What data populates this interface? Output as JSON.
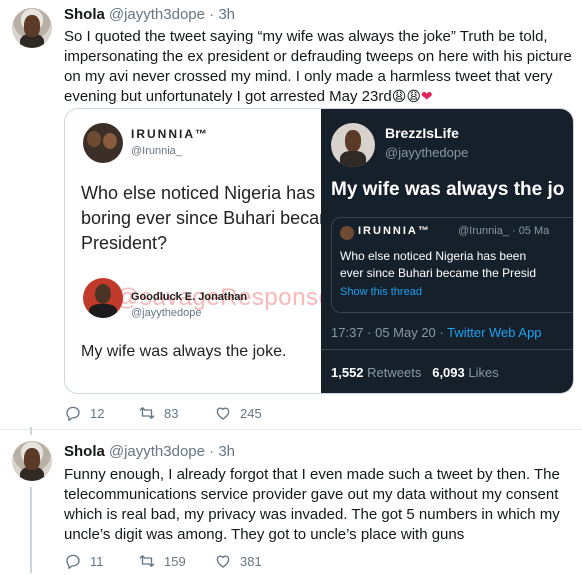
{
  "tweets": [
    {
      "author": "Shola",
      "handle": "@jayyth3dope",
      "time": "3h",
      "text": "So I quoted the tweet saying “my wife was always the joke” Truth be told, impersonating the ex president or defrauding tweeps on here with his picture on my avi never crossed my mind. I only made a harmless tweet that very evening but unfortunately I got arrested May 23rd",
      "emojis": [
        "😩",
        "😩",
        "❤"
      ],
      "reply_count": "12",
      "retweet_count": "83",
      "like_count": "245"
    },
    {
      "author": "Shola",
      "handle": "@jayyth3dope",
      "time": "3h",
      "text": "Funny enough, I already forgot that I even made such a tweet by then. The telecommunications service provider gave out my data without my consent which is real bad, my privacy was invaded. The got 5 numbers in which my uncle’s digit was among. They got to uncle’s place with guns",
      "reply_count": "11",
      "retweet_count": "159",
      "like_count": "381"
    }
  ],
  "embed": {
    "left": {
      "name": "IRUNNIA™",
      "handle": "@Irunnia_",
      "text_lines": [
        "Who else noticed Nigeria has be",
        "boring ever since Buhari became",
        "President?"
      ],
      "watermark": "@savageResponses",
      "reply_name": "Goodluck E. Jonathan",
      "reply_handle": "@jayythedope",
      "reply_text": "My wife was always the joke."
    },
    "right": {
      "name": "BrezzIsLife",
      "handle": "@jayythedope",
      "text": "My wife was always the jo",
      "quote_name": "IRUNNIA™",
      "quote_handle": "@Irunnia_ · 05 Ma",
      "quote_lines": [
        "Who else noticed Nigeria has been",
        "ever since Buhari became the Presid"
      ],
      "show_thread": "Show this thread",
      "time": "17:37 · 05 May 20 · ",
      "app": "Twitter Web App",
      "retweets_value": "1,552",
      "retweets_label": "Retweets",
      "likes_value": "6,093",
      "likes_label": "Likes"
    }
  },
  "colors": {
    "text": "#14171a",
    "muted": "#657786",
    "link": "#1da1f2",
    "dark_bg": "#15202b",
    "heart": "#e0245e"
  },
  "icons": [
    "reply-icon",
    "retweet-icon",
    "like-icon"
  ]
}
